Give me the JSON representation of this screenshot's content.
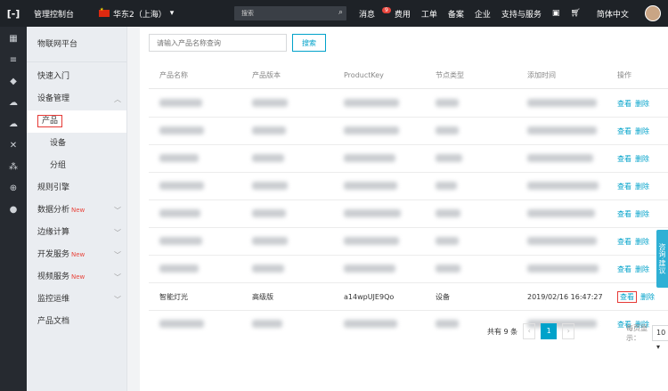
{
  "topbar": {
    "logo": "[-]",
    "console_title": "管理控制台",
    "region": "华东2（上海）",
    "search_placeholder": "搜索",
    "nav": [
      {
        "label": "消息",
        "badge": "9"
      },
      {
        "label": "费用"
      },
      {
        "label": "工单"
      },
      {
        "label": "备案"
      },
      {
        "label": "企业"
      },
      {
        "label": "支持与服务"
      }
    ],
    "language": "简体中文"
  },
  "sidebar": {
    "title": "物联网平台",
    "items": [
      {
        "label": "快速入门"
      },
      {
        "label": "设备管理",
        "expanded": true
      },
      {
        "label": "产品",
        "sub": true,
        "active": true
      },
      {
        "label": "设备",
        "sub": true
      },
      {
        "label": "分组",
        "sub": true
      },
      {
        "label": "规则引擎"
      },
      {
        "label": "数据分析",
        "new": "New",
        "chevron": true
      },
      {
        "label": "边缘计算",
        "chevron": true
      },
      {
        "label": "开发服务",
        "new": "New",
        "chevron": true
      },
      {
        "label": "视频服务",
        "new": "New",
        "chevron": true
      },
      {
        "label": "监控运维",
        "chevron": true
      },
      {
        "label": "产品文档"
      }
    ]
  },
  "filter": {
    "placeholder": "请输入产品名称查询",
    "search_button": "搜索"
  },
  "table": {
    "headers": [
      "产品名称",
      "产品版本",
      "ProductKey",
      "节点类型",
      "添加时间",
      "操作"
    ],
    "action_view": "查看",
    "action_delete": "删除",
    "highlight_row": {
      "name": "智能灯光",
      "version": "高级版",
      "product_key": "a14wpUJE9Qo",
      "node_type": "设备",
      "added": "2019/02/16 16:47:27"
    }
  },
  "pager": {
    "total": "共有 9 条",
    "current": "1",
    "page_size_label": "每页显示：",
    "page_size": "10"
  },
  "feedback": "咨询·建议"
}
